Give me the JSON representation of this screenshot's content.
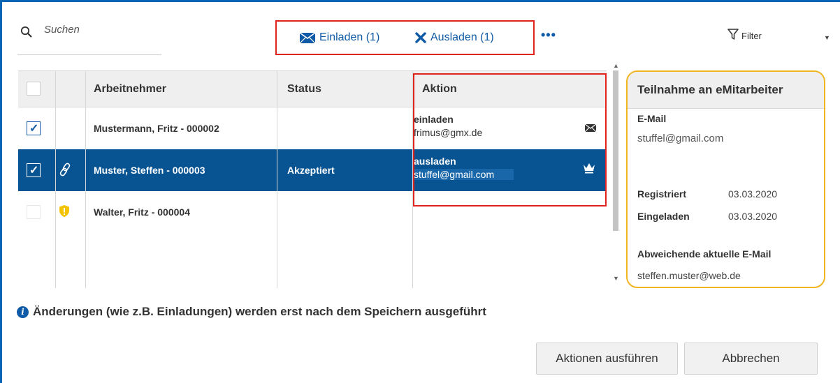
{
  "toolbar": {
    "search_placeholder": "Suchen",
    "invite_label": "Einladen (1)",
    "uninvite_label": "Ausladen (1)",
    "more_label": "•••",
    "filter_label": "Filter"
  },
  "table": {
    "headers": [
      "Arbeitnehmer",
      "Status",
      "Aktion"
    ],
    "rows": [
      {
        "name": "Mustermann, Fritz - 000002",
        "status": "",
        "action": "einladen",
        "email": "frimus@gmx.de",
        "checked": true,
        "selected": false,
        "row_icon": ""
      },
      {
        "name": "Muster, Steffen - 000003",
        "status": "Akzeptiert",
        "action": "ausladen",
        "email": "stuffel@gmail.com",
        "checked": true,
        "selected": true,
        "row_icon": "link-icon"
      },
      {
        "name": "Walter, Fritz - 000004",
        "status": "",
        "action": "",
        "email": "",
        "checked": false,
        "selected": false,
        "row_icon": "shield-warning-icon"
      }
    ]
  },
  "panel": {
    "title": "Teilnahme an eMitarbeiter",
    "email_label": "E-Mail",
    "email_value": "stuffel@gmail.com",
    "registered_label": "Registriert",
    "registered_date": "03.03.2020",
    "invited_label": "Eingeladen",
    "invited_date": "03.03.2020",
    "alt_email_label": "Abweichende aktuelle E-Mail",
    "alt_email_value": "steffen.muster@web.de"
  },
  "footer": {
    "info_text": "Änderungen (wie z.B. Einladungen) werden erst nach dem Speichern ausgeführt",
    "run_button": "Aktionen ausführen",
    "cancel_button": "Abbrechen"
  },
  "colors": {
    "accent": "#0f5aa6",
    "selected_row": "#085493",
    "highlight_red": "#e0231f",
    "highlight_yellow": "#f0b51f",
    "warning_yellow": "#f3c200"
  }
}
